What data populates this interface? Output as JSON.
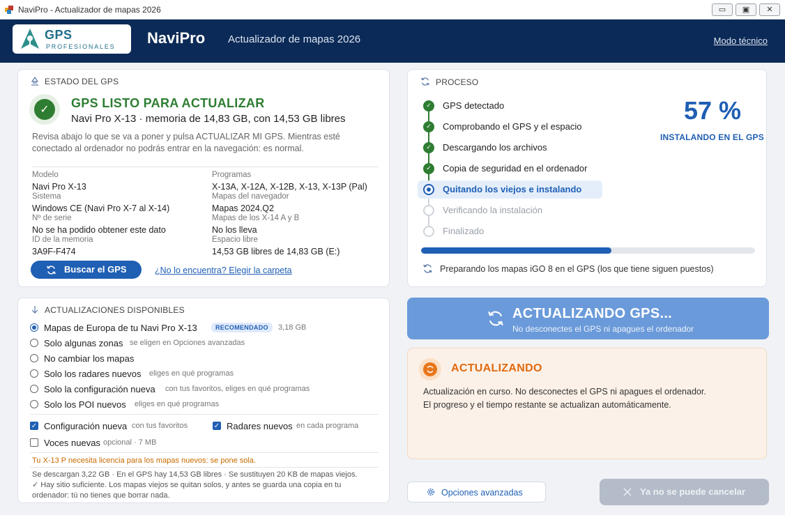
{
  "window": {
    "title": "NaviPro - Actualizador de mapas 2026",
    "min_glyph": "▭",
    "max_glyph": "▣",
    "close_glyph": "✕"
  },
  "header": {
    "logo_main": "GPS",
    "logo_sub": "PROFESIONALES",
    "brand": "NaviPro",
    "subtitle": "Actualizador de mapas 2026",
    "tech_mode_link": "Modo técnico"
  },
  "estado": {
    "heading": "ESTADO DEL GPS",
    "status_check": "✓",
    "status_title": "GPS LISTO PARA ACTUALIZAR",
    "status_model": "Navi Pro X-13   ·   memoria de 14,83 GB, con 14,53 GB libres",
    "desc_line1": "Revisa abajo lo que se va a poner y pulsa ACTUALIZAR MI GPS. Mientras esté",
    "desc_line2": "conectado al ordenador no podrás entrar en la navegación: es normal.",
    "fields": {
      "modelo_label": "Modelo",
      "modelo_value": "Navi Pro X-13",
      "sistema_label": "Sistema",
      "sistema_value": "Windows CE (Navi Pro X-7 al X-14)",
      "serie_label": "Nº de serie",
      "serie_value": "No se ha podido obtener este dato",
      "id_label": "ID de la memoria",
      "id_value": "3A9F-F474",
      "programas_label": "Programas",
      "programas_value": "X-13A, X-12A, X-12B, X-13, X-13P (Pal)",
      "mapas_label": "Mapas del navegador",
      "mapas_value": "Mapas 2024.Q2",
      "mapas_ab_label": "Mapas de los X-14 A y B",
      "mapas_ab_value": "No los lleva",
      "espacio_label": "Espacio libre",
      "espacio_value": "14,53 GB libres de 14,83 GB   (E:)"
    },
    "search_button": "Buscar el GPS",
    "folder_link": "¿No lo encuentra? Elegir la carpeta"
  },
  "updates": {
    "heading": "ACTUALIZACIONES DISPONIBLES",
    "options": [
      {
        "label": "Mapas de Europa de tu Navi Pro X-13",
        "badge": "RECOMENDADO",
        "hint": "3,18 GB",
        "selected": true
      },
      {
        "label": "Solo algunas zonas",
        "hint": "se eligen en Opciones avanzadas",
        "selected": false
      },
      {
        "label": "No cambiar los mapas",
        "hint": "",
        "selected": false
      },
      {
        "label": "Solo los radares nuevos",
        "hint": "eliges en qué programas",
        "selected": false
      },
      {
        "label": "Solo la configuración nueva",
        "hint": "con tus favoritos, eliges en qué programas",
        "selected": false
      },
      {
        "label": "Solo los POI nuevos",
        "hint": "eliges en qué programas",
        "selected": false
      }
    ],
    "checks": [
      {
        "label": "Configuración nueva",
        "hint": "con tus favoritos",
        "checked": true
      },
      {
        "label": "Radares nuevos",
        "hint": "en cada programa",
        "checked": true
      },
      {
        "label": "Voces nuevas",
        "hint": "opcional · 7 MB",
        "checked": false
      }
    ],
    "check_glyph": "✓",
    "warning": "Tu X-13 P necesita licencia para los mapas nuevos: se pone sola.",
    "note1": "Se descargan 3,22 GB · En el GPS hay 14,53 GB libres · Se sustituyen 20 KB de mapas viejos.",
    "note2": "✓ Hay sitio suficiente. Los mapas viejos se quitan solos, y antes se guarda una copia en tu",
    "note3": "ordenador: tú no tienes que borrar nada."
  },
  "proceso": {
    "heading": "PROCESO",
    "done_glyph": "✓",
    "steps": [
      {
        "label": "GPS detectado",
        "state": "done"
      },
      {
        "label": "Comprobando el GPS y el espacio",
        "state": "done"
      },
      {
        "label": "Descargando los archivos",
        "state": "done"
      },
      {
        "label": "Copia de seguridad en el ordenador",
        "state": "done"
      },
      {
        "label": "Quitando los viejos e instalando",
        "state": "active"
      },
      {
        "label": "Verificando la instalación",
        "state": "pending"
      },
      {
        "label": "Finalizado",
        "state": "pending"
      }
    ],
    "percent_text": "57 %",
    "percent_value": 57,
    "percent_label": "INSTALANDO EN EL GPS",
    "prep_text": "Preparando los mapas iGO 8 en el GPS (los que tiene siguen puestos)"
  },
  "big_button": {
    "title": "ACTUALIZANDO GPS...",
    "subtitle": "No desconectes el GPS ni apagues el ordenador"
  },
  "updating_panel": {
    "title": "ACTUALIZANDO",
    "line1": "Actualización en curso. No desconectes el GPS ni apagues el ordenador.",
    "line2": "El progreso y el tiempo restante se actualizan automáticamente."
  },
  "bottom": {
    "advanced_button": "Opciones avanzadas",
    "cancel_button": "Ya no se puede cancelar"
  },
  "colors": {
    "accent": "#1f5fb4",
    "success": "#2f7d32",
    "warning": "#e06a10",
    "header_bg": "#0c2a57"
  }
}
